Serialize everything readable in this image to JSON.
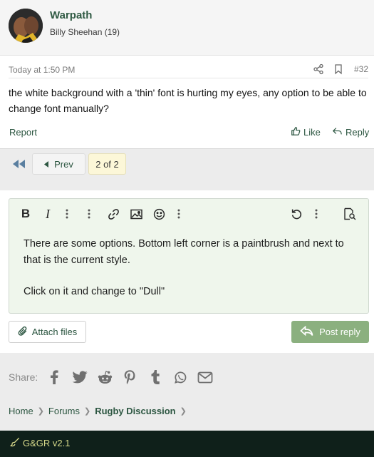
{
  "post": {
    "username": "Warpath",
    "user_title": "Billy Sheehan (19)",
    "date": "Today at 1:50 PM",
    "post_number": "#32",
    "body": "the white background with a 'thin' font is hurting my eyes, any option to be able to change font manually?",
    "report_label": "Report",
    "like_label": "Like",
    "reply_label": "Reply"
  },
  "pagination": {
    "prev_label": "Prev",
    "current": "2 of 2"
  },
  "editor": {
    "lines": [
      "There are some options. Bottom left corner is a paintbrush and next to that is the current style.",
      "Click on it and change to \"Dull\""
    ],
    "toolbar_icons": [
      "bold-icon",
      "italic-icon",
      "more-text-icon",
      "more-options-icon",
      "link-icon",
      "image-icon",
      "smilie-icon",
      "insert-more-icon",
      "undo-icon",
      "more-icon",
      "preview-icon"
    ]
  },
  "actions": {
    "attach_label": "Attach files",
    "post_reply_label": "Post reply"
  },
  "share": {
    "label": "Share:",
    "networks": [
      "facebook",
      "twitter",
      "reddit",
      "pinterest",
      "tumblr",
      "whatsapp",
      "email"
    ]
  },
  "breadcrumb": [
    "Home",
    "Forums",
    "Rugby Discussion"
  ],
  "footer": {
    "style_label": "G&GR v2.1"
  },
  "colors": {
    "link": "#2c5641",
    "username": "#2f5a43",
    "post_reply_bg": "#8bb07f",
    "editor_bg": "#eff6ec",
    "footer_bg": "#0f201a",
    "current_page_bg": "#fcf7d8"
  }
}
